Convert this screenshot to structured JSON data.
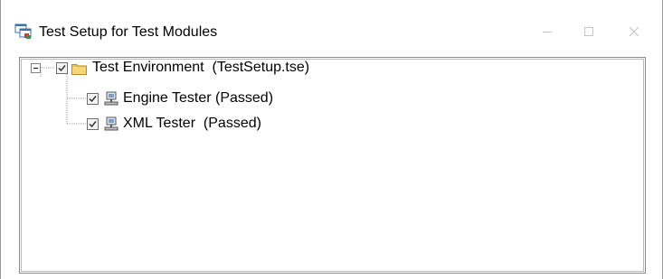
{
  "window": {
    "title": "Test Setup for Test Modules",
    "controls": {
      "minimize": "minimize",
      "maximize": "maximize",
      "close": "close"
    }
  },
  "tree": {
    "root": {
      "label": "Test Environment  (TestSetup.tse)",
      "checked": true,
      "expanded": true,
      "icon": "folder-icon"
    },
    "children": [
      {
        "label": "Engine Tester (Passed)",
        "checked": true,
        "icon": "computer-icon"
      },
      {
        "label": "XML Tester  (Passed)",
        "checked": true,
        "icon": "computer-icon"
      }
    ]
  },
  "colors": {
    "folder": "#f3c24b",
    "check": "#2a2a2a",
    "caption_buttons": "#c4c4c4"
  }
}
